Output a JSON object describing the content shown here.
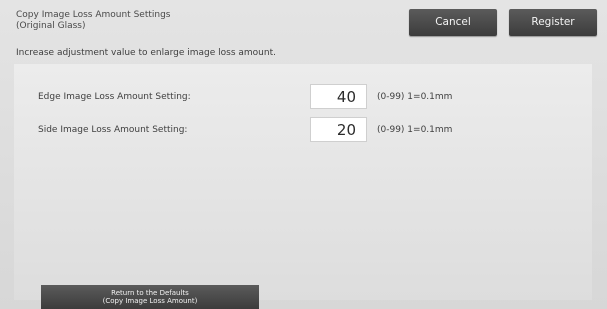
{
  "header": {
    "title_line1": "Copy Image Loss Amount Settings",
    "title_line2": "(Original Glass)",
    "cancel_label": "Cancel",
    "register_label": "Register"
  },
  "instruction": "Increase adjustment value to enlarge image loss amount.",
  "settings": [
    {
      "label": "Edge Image Loss Amount Setting:",
      "value": "40",
      "range": "(0-99) 1=0.1mm"
    },
    {
      "label": "Side Image Loss Amount Setting:",
      "value": "20",
      "range": "(0-99) 1=0.1mm"
    }
  ],
  "defaults_button": {
    "line1": "Return to the Defaults",
    "line2": "(Copy Image Loss Amount)"
  },
  "colors": {
    "button_dark": "#4a4a4a",
    "background": "#dcdcdc"
  }
}
